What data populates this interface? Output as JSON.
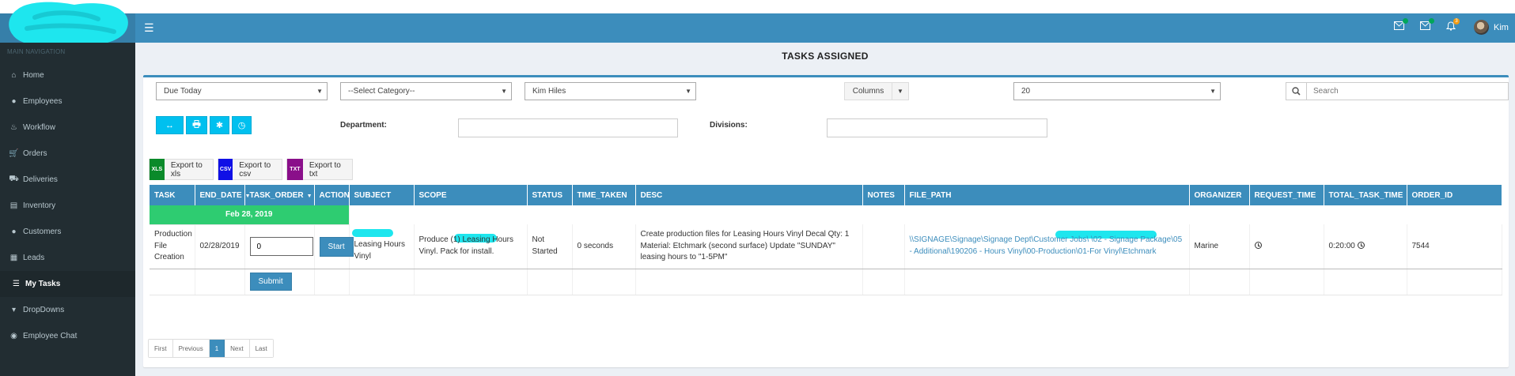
{
  "header": {
    "user_name": "Kim",
    "badges": [
      {
        "icon": "envelope-icon",
        "color": "#00a65a"
      },
      {
        "icon": "envelope-icon",
        "color": "#00a65a"
      },
      {
        "icon": "bell-icon",
        "color": "#f39c12",
        "count": "3"
      }
    ]
  },
  "sidebar": {
    "header": "MAIN NAVIGATION",
    "items": [
      {
        "label": "Home",
        "icon": "home-icon"
      },
      {
        "label": "Employees",
        "icon": "user-icon"
      },
      {
        "label": "Workflow",
        "icon": "workflow-icon"
      },
      {
        "label": "Orders",
        "icon": "cart-icon"
      },
      {
        "label": "Deliveries",
        "icon": "truck-icon"
      },
      {
        "label": "Inventory",
        "icon": "inventory-icon"
      },
      {
        "label": "Customers",
        "icon": "user-icon"
      },
      {
        "label": "Leads",
        "icon": "leads-icon"
      },
      {
        "label": "My Tasks",
        "icon": "tasks-icon"
      },
      {
        "label": "DropDowns",
        "icon": "caret-down-icon"
      },
      {
        "label": "Employee Chat",
        "icon": "chat-icon"
      }
    ]
  },
  "page": {
    "title": "TASKS ASSIGNED"
  },
  "filters": {
    "due": "Due Today",
    "category": "--Select Category--",
    "assignee": "Kim Hiles",
    "columns_label": "Columns",
    "page_size": "20",
    "search_placeholder": "Search",
    "department_label": "Department:",
    "divisions_label": "Divisions:"
  },
  "exports": {
    "xls_label": "Export to xls",
    "csv_label": "Export to csv",
    "txt_label": "Export to txt",
    "xls_color": "#0a8a2a",
    "csv_color": "#1010e6",
    "txt_color": "#8a0f8a"
  },
  "table": {
    "headers": [
      "TASK",
      "END_DATE",
      "TASK_ORDER",
      "ACTION",
      "SUBJECT",
      "SCOPE",
      "STATUS",
      "TIME_TAKEN",
      "DESC",
      "NOTES",
      "FILE_PATH",
      "ORGANIZER",
      "REQUEST_TIME",
      "TOTAL_TASK_TIME",
      "ORDER_ID"
    ],
    "group_label": "Feb 28, 2019",
    "row": {
      "task": "Production File Creation",
      "end_date": "02/28/2019",
      "task_order": "0",
      "action": "Start",
      "subject": "Leasing Hours Vinyl",
      "scope": "Produce (1) Leasing Hours Vinyl. Pack for install.",
      "status": "Not Started",
      "time_taken": "0 seconds",
      "desc": "Create production files for Leasing Hours Vinyl Decal Qty: 1 Material: Etchmark (second surface) Update \"SUNDAY\" leasing hours to \"1-5PM\"",
      "notes": "",
      "file_path": "\\\\SIGNAGE\\Signage\\Signage Dept\\Customer Jobs\\ \\02 - Signage Package\\05 - Additional\\190206 - Hours Vinyl\\00-Production\\01-For Vinyl\\Etchmark",
      "organizer": "Marine",
      "total_task_time": "0:20:00",
      "order_id": "7544"
    },
    "submit_label": "Submit"
  },
  "pagination": {
    "first": "First",
    "previous": "Previous",
    "current": "1",
    "next": "Next",
    "last": "Last"
  }
}
